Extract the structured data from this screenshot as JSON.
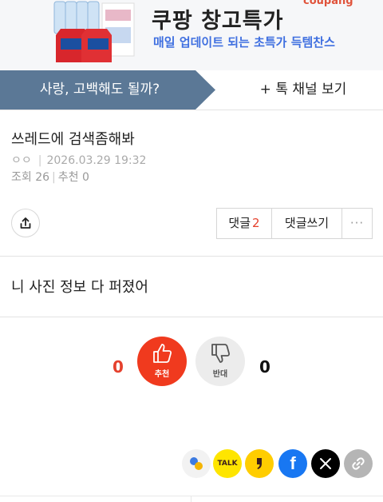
{
  "ad": {
    "title": "쿠팡 창고특가",
    "subtitle": "매일 업데이트 되는 초특가 득템찬스",
    "brand": "coupang"
  },
  "channel": {
    "name": "사랑, 고백해도 될까?",
    "view_label": "+ 톡 채널 보기",
    "accent": "#5b7896"
  },
  "post": {
    "title": "쓰레드에 검색좀해봐",
    "author": "ㅇㅇ",
    "date": "2026.03.29 19:32",
    "views_label": "조회",
    "views": "26",
    "recommend_label": "추천",
    "recommend": "0",
    "body": "니 사진 정보 다 퍼졌어"
  },
  "comments": {
    "label": "댓글",
    "count": "2",
    "write_label": "댓글쓰기",
    "more": "···"
  },
  "votes": {
    "up_count": "0",
    "up_label": "추천",
    "down_count": "0",
    "down_label": "반대",
    "up_color": "#f03a1e"
  },
  "share": {
    "icons": [
      "band-icon",
      "kakaotalk-icon",
      "kakaostory-icon",
      "facebook-icon",
      "x-icon",
      "link-icon"
    ],
    "talk_label": "TALK",
    "fb_label": "f",
    "x_label": "𝕏"
  }
}
